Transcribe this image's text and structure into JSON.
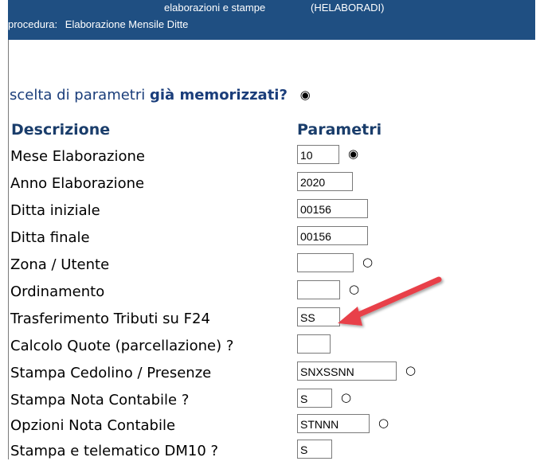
{
  "header": {
    "program": "elaborazioni e stampe",
    "program_code": "(HELABORADI)",
    "procedure_label": "procedura:",
    "procedure_name": "Elaborazione Mensile Ditte"
  },
  "question": {
    "prefix": "scelta di parametri",
    "bold": "già memorizzati?",
    "radio": "◉"
  },
  "columns": {
    "descrizione": "Descrizione",
    "parametri": "Parametri"
  },
  "rows": [
    {
      "label": "Mese Elaborazione",
      "value": "10",
      "radio": "◉"
    },
    {
      "label": "Anno Elaborazione",
      "value": "2020",
      "radio": ""
    },
    {
      "label": "Ditta iniziale",
      "value": "00156",
      "radio": ""
    },
    {
      "label": "Ditta finale",
      "value": "00156",
      "radio": ""
    },
    {
      "label": "Zona / Utente",
      "value": "",
      "radio": "○"
    },
    {
      "label": "Ordinamento",
      "value": "",
      "radio": "○"
    },
    {
      "label": "Trasferimento Tributi su F24",
      "value": "SS",
      "radio": "○"
    },
    {
      "label": "Calcolo Quote (parcellazione) ?",
      "value": "",
      "radio": ""
    },
    {
      "label": "Stampa Cedolino / Presenze",
      "value": "SNXSSNN",
      "radio": "○"
    },
    {
      "label": "Stampa Nota Contabile ?",
      "value": "S",
      "radio": "○"
    },
    {
      "label": "Opzioni Nota Contabile",
      "value": "STNNN",
      "radio": "○"
    },
    {
      "label": "Stampa e telematico DM10 ?",
      "value": "S",
      "radio": ""
    }
  ],
  "colors": {
    "header_bg": "#1f4f82",
    "heading": "#1a3d6b",
    "arrow": "#e8404a"
  }
}
